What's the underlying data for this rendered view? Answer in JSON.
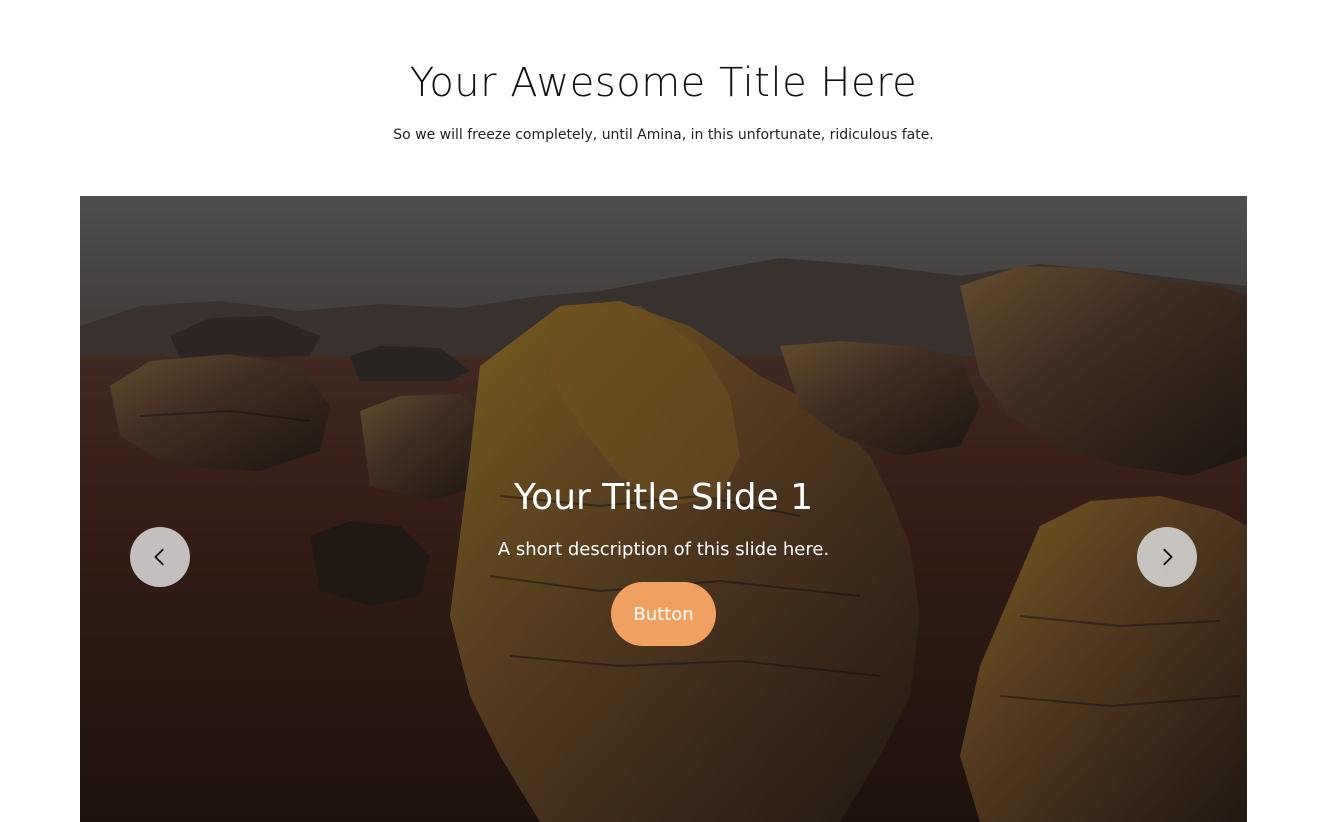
{
  "header": {
    "title": "Your Awesome Title Here",
    "subtitle": "So we will freeze completely, until Amina, in this unfortunate, ridiculous fate."
  },
  "slider": {
    "slides": [
      {
        "title": "Your Title Slide 1",
        "description": "A short description of this slide here.",
        "button_label": "Button"
      }
    ],
    "prev_icon": "chevron-left-icon",
    "next_icon": "chevron-right-icon",
    "colors": {
      "button_bg": "#f0a060",
      "nav_bg": "#dcdcdc"
    }
  }
}
